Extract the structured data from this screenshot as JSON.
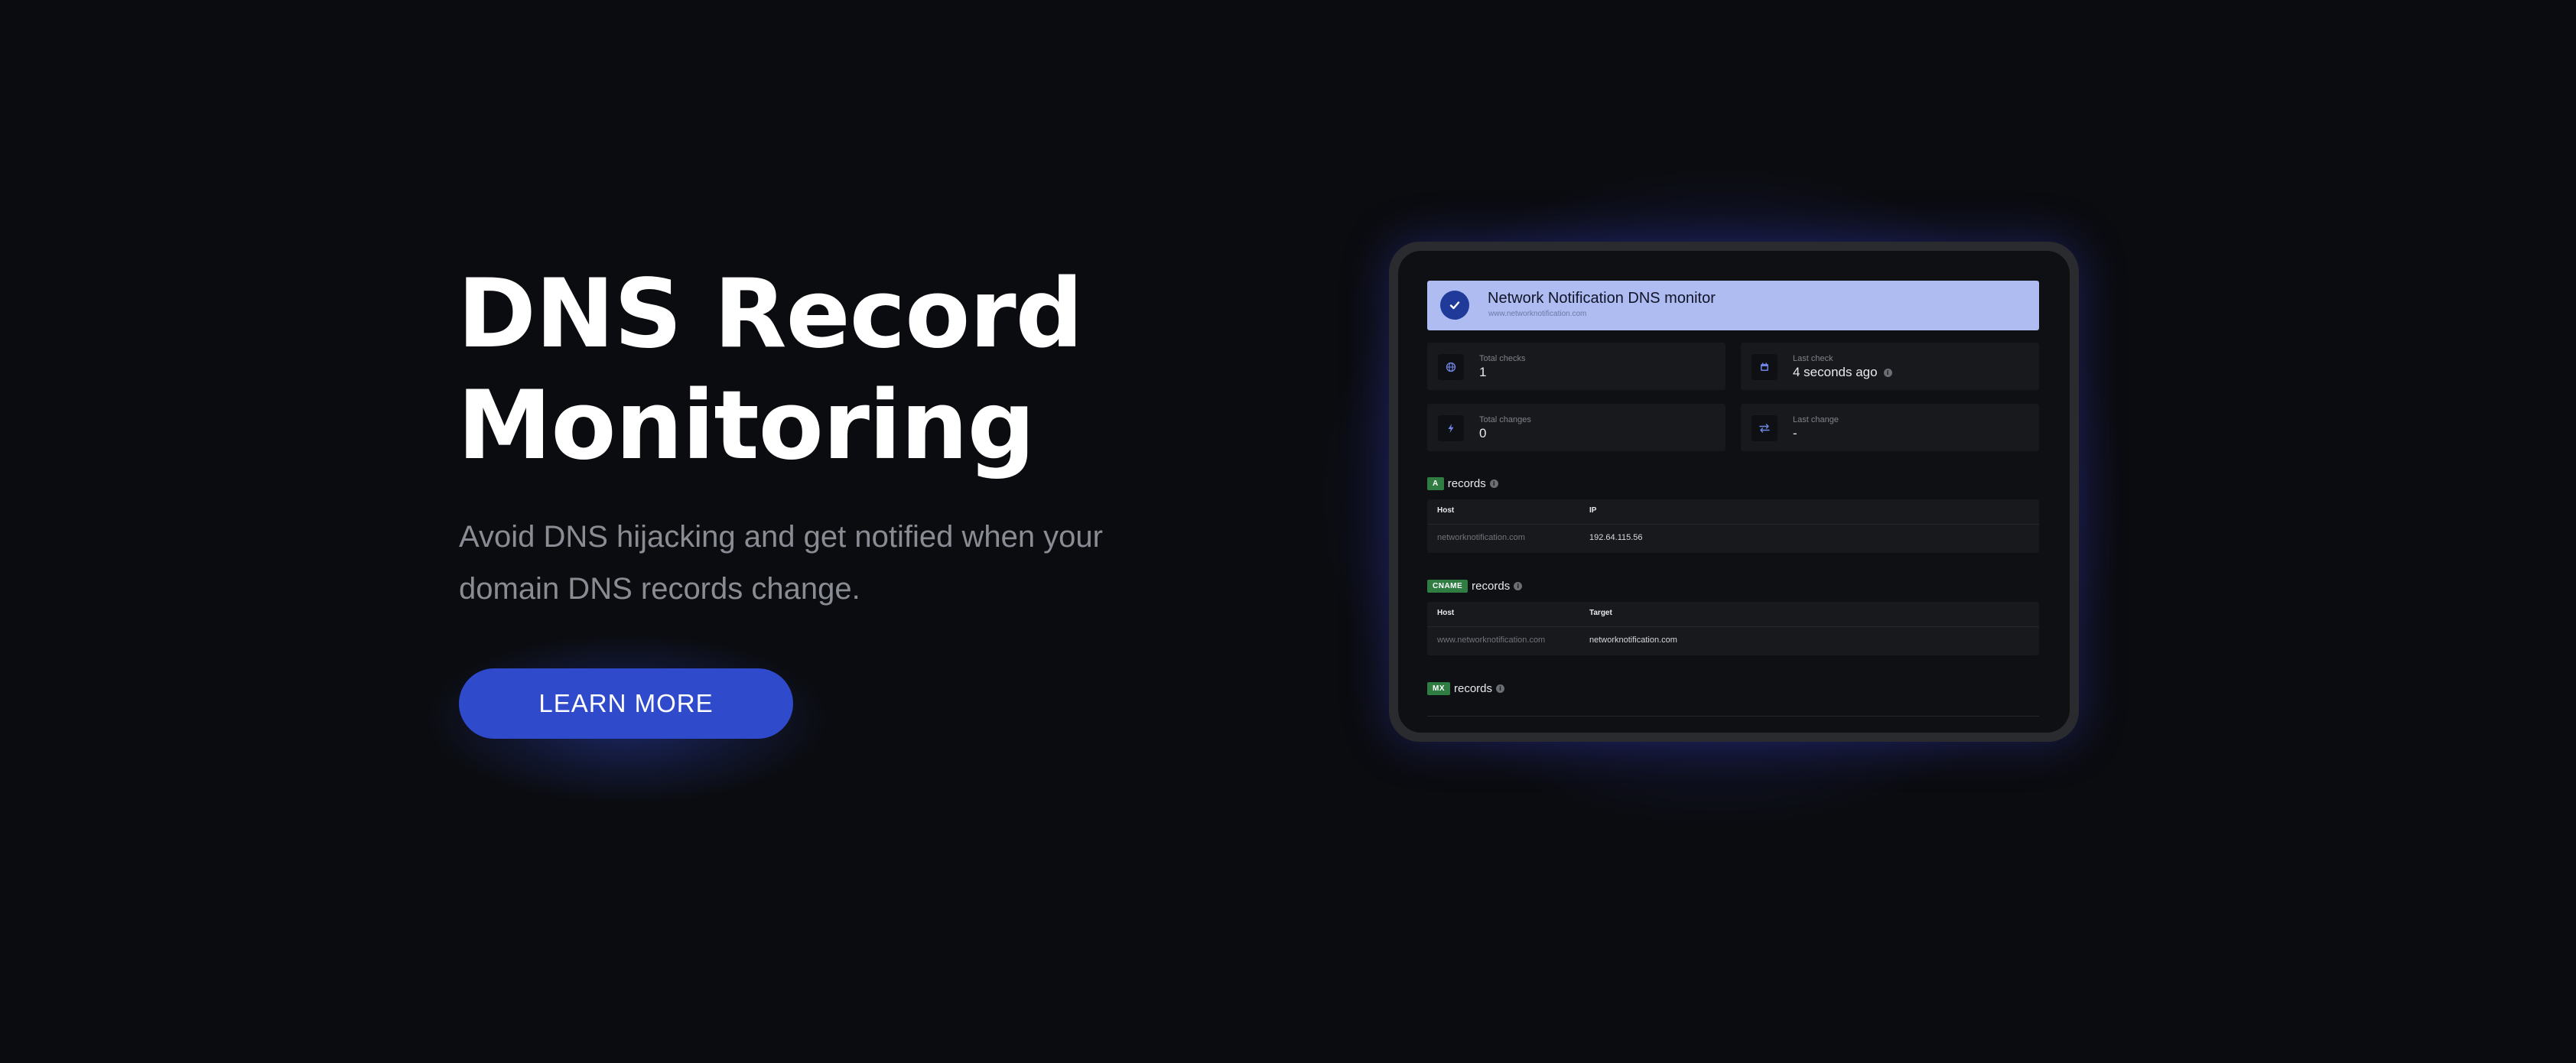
{
  "hero": {
    "title_line1": "DNS Record",
    "title_line2": "Monitoring",
    "subtitle_line1": "Avoid DNS hijacking and get notified when your",
    "subtitle_line2": "domain DNS records change.",
    "cta_label": "LEARN MORE"
  },
  "monitor": {
    "title": "Network Notification DNS monitor",
    "url": "www.networknotification.com",
    "status_icon": "check-icon",
    "stats": [
      {
        "label": "Total checks",
        "value": "1",
        "icon": "globe-icon"
      },
      {
        "label": "Last check",
        "value": "4 seconds ago",
        "icon": "calendar-icon",
        "info": true
      },
      {
        "label": "Total changes",
        "value": "0",
        "icon": "lightning-icon"
      },
      {
        "label": "Last change",
        "value": "-",
        "icon": "swap-arrows-icon"
      }
    ],
    "records": [
      {
        "type": "A",
        "label": "records",
        "columns": [
          "Host",
          "IP"
        ],
        "rows": [
          [
            "networknotification.com",
            "192.64.115.56"
          ]
        ]
      },
      {
        "type": "CNAME",
        "label": "records",
        "columns": [
          "Host",
          "Target"
        ],
        "rows": [
          [
            "www.networknotification.com",
            "networknotification.com"
          ]
        ]
      },
      {
        "type": "MX",
        "label": "records"
      }
    ]
  },
  "colors": {
    "background": "#0b0c10",
    "accent": "#2f4bcc",
    "header_bg": "#aebcf1",
    "badge_green": "#2f7d43"
  }
}
